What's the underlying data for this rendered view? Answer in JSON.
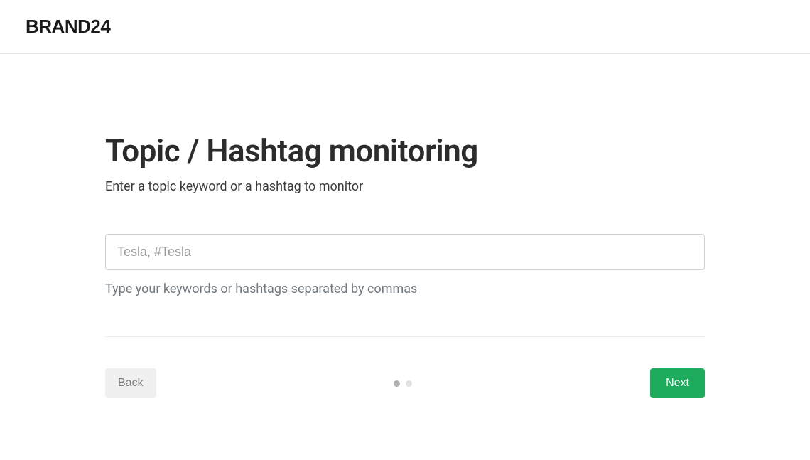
{
  "header": {
    "logo": "BRAND24"
  },
  "main": {
    "title": "Topic / Hashtag monitoring",
    "subtitle": "Enter a topic keyword or a hashtag to monitor",
    "input": {
      "value": "",
      "placeholder": "Tesla, #Tesla"
    },
    "hint": "Type your keywords or hashtags separated by commas"
  },
  "footer": {
    "back_label": "Back",
    "next_label": "Next",
    "dots": {
      "total": 2,
      "active_index": 0
    }
  }
}
